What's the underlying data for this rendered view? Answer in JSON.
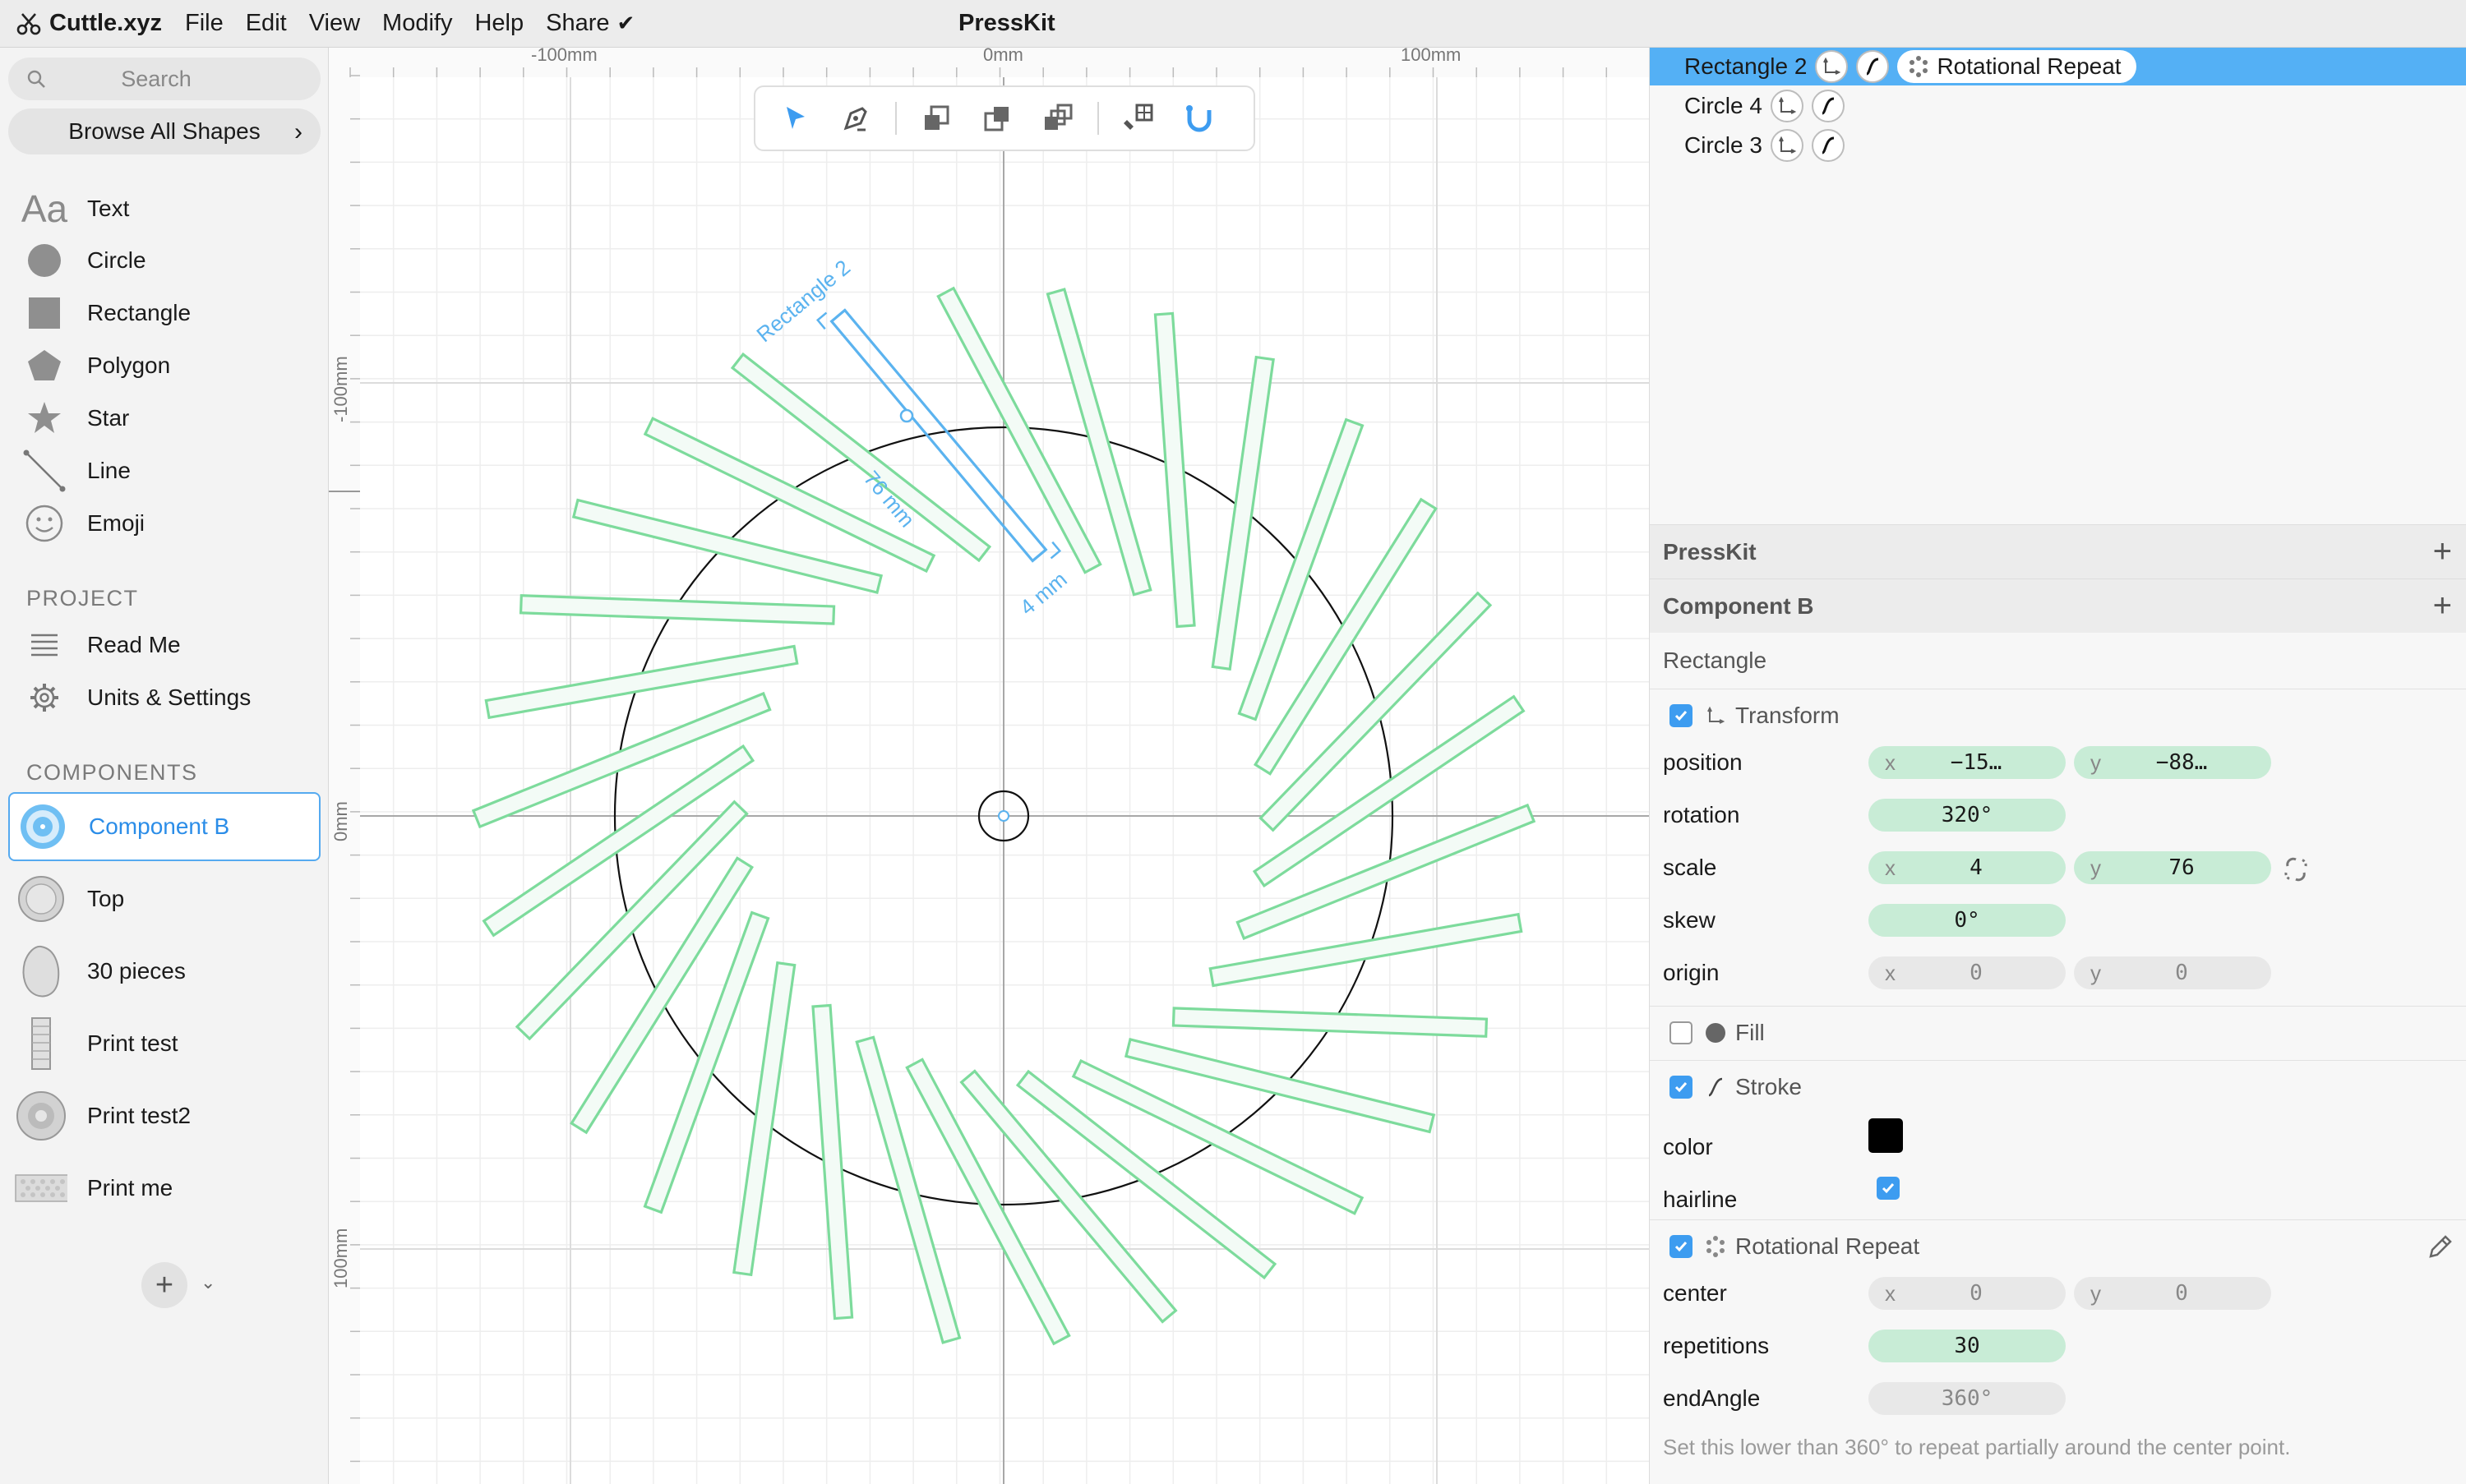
{
  "menubar": {
    "app_name": "Cuttle.xyz",
    "items": [
      "File",
      "Edit",
      "View",
      "Modify",
      "Help",
      "Share"
    ],
    "document_title": "PressKit"
  },
  "sidebar": {
    "search_placeholder": "Search",
    "browse_label": "Browse All Shapes",
    "shapes": [
      {
        "label": "Text",
        "icon": "text-aa-icon"
      },
      {
        "label": "Circle",
        "icon": "circle-icon"
      },
      {
        "label": "Rectangle",
        "icon": "rectangle-icon"
      },
      {
        "label": "Polygon",
        "icon": "polygon-icon"
      },
      {
        "label": "Star",
        "icon": "star-icon"
      },
      {
        "label": "Line",
        "icon": "line-icon"
      },
      {
        "label": "Emoji",
        "icon": "emoji-icon"
      }
    ],
    "project_heading": "PROJECT",
    "project_items": [
      {
        "label": "Read Me",
        "icon": "list-icon"
      },
      {
        "label": "Units & Settings",
        "icon": "gear-icon"
      }
    ],
    "components_heading": "COMPONENTS",
    "components": [
      {
        "label": "Component B",
        "selected": true
      },
      {
        "label": "Top",
        "selected": false
      },
      {
        "label": "30 pieces",
        "selected": false
      },
      {
        "label": "Print test",
        "selected": false
      },
      {
        "label": "Print test2",
        "selected": false
      },
      {
        "label": "Print me",
        "selected": false
      }
    ]
  },
  "canvas": {
    "ruler_top": [
      "-100mm",
      "0mm",
      "100mm"
    ],
    "ruler_left": [
      "-100mm",
      "0mm",
      "100mm"
    ],
    "annotation": {
      "shape_name": "Rectangle 2",
      "length": "76 mm",
      "width": "4 mm"
    },
    "repeat_count": 30,
    "colors": {
      "repeat": "#7ddb9c",
      "selected": "#5bb3ef",
      "circle": "#111111"
    }
  },
  "layers": [
    {
      "name": "Rectangle 2",
      "selected": true,
      "modifier": "Rotational Repeat"
    },
    {
      "name": "Circle 4",
      "selected": false
    },
    {
      "name": "Circle 3",
      "selected": false
    }
  ],
  "inspector": {
    "project": "PressKit",
    "component": "Component B",
    "shape_type": "Rectangle",
    "transform": {
      "title": "Transform",
      "enabled": true,
      "position_label": "position",
      "position_x": "−15…",
      "position_y": "−88…",
      "rotation_label": "rotation",
      "rotation": "320°",
      "scale_label": "scale",
      "scale_x": "4",
      "scale_y": "76",
      "skew_label": "skew",
      "skew": "0°",
      "origin_label": "origin",
      "origin_x": "0",
      "origin_y": "0"
    },
    "fill": {
      "title": "Fill",
      "enabled": false
    },
    "stroke": {
      "title": "Stroke",
      "enabled": true,
      "color_label": "color",
      "color": "#000000",
      "hairline_label": "hairline",
      "hairline": true
    },
    "rotational_repeat": {
      "title": "Rotational Repeat",
      "enabled": true,
      "center_label": "center",
      "center_x": "0",
      "center_y": "0",
      "repetitions_label": "repetitions",
      "repetitions": "30",
      "end_angle_label": "endAngle",
      "end_angle": "360°",
      "help": "Set this lower than 360° to repeat partially around the center point."
    }
  },
  "axis_letters": {
    "x": "x",
    "y": "y"
  }
}
